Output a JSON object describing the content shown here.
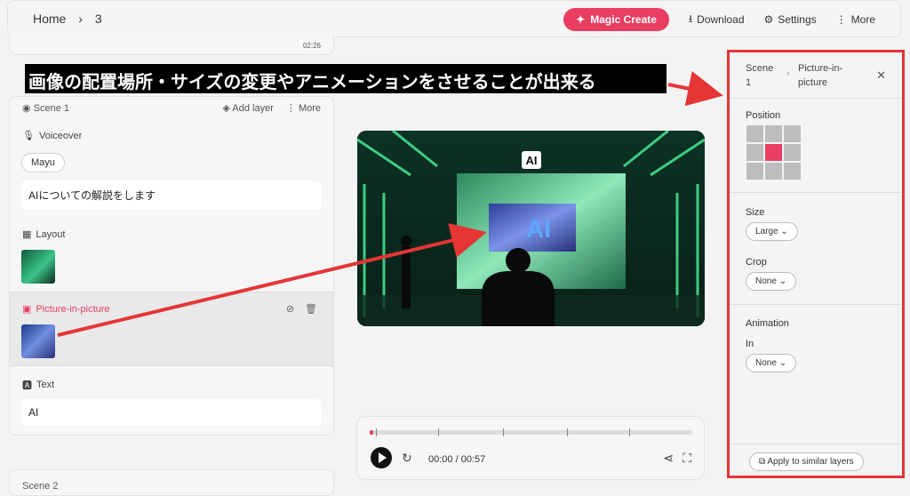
{
  "breadcrumb": {
    "home": "Home",
    "sep": "›",
    "current": "3"
  },
  "toolbar": {
    "magic": "Magic Create",
    "download": "Download",
    "settings": "Settings",
    "more": "More"
  },
  "scene_prev_time": "02:26",
  "banner": "画像の配置場所・サイズの変更やアニメーションをさせることが出来る",
  "scene1": {
    "title": "Scene 1",
    "add_layer": "Add layer",
    "more": "More",
    "voiceover_label": "Voiceover",
    "voice": "Mayu",
    "voice_text": "AIについての解説をします",
    "layout_label": "Layout",
    "pip_label": "Picture-in-picture",
    "text_label": "Text",
    "text_value": "AI"
  },
  "scene2_title": "Scene 2",
  "video": {
    "ai_label": "AI",
    "inset_text": "AI"
  },
  "player": {
    "time": "00:00 / 00:57",
    "progress": 0.01
  },
  "panel": {
    "crumb_scene": "Scene 1",
    "crumb_sep": "›",
    "crumb_layer": "Picture-in-picture",
    "position_label": "Position",
    "position_selected": 4,
    "size_label": "Size",
    "size_value": "Large",
    "crop_label": "Crop",
    "crop_value": "None",
    "animation_label": "Animation",
    "in_label": "In",
    "in_value": "None",
    "apply": "Apply to similar layers"
  },
  "colors": {
    "accent": "#e83e62",
    "annotation": "#e53535"
  }
}
